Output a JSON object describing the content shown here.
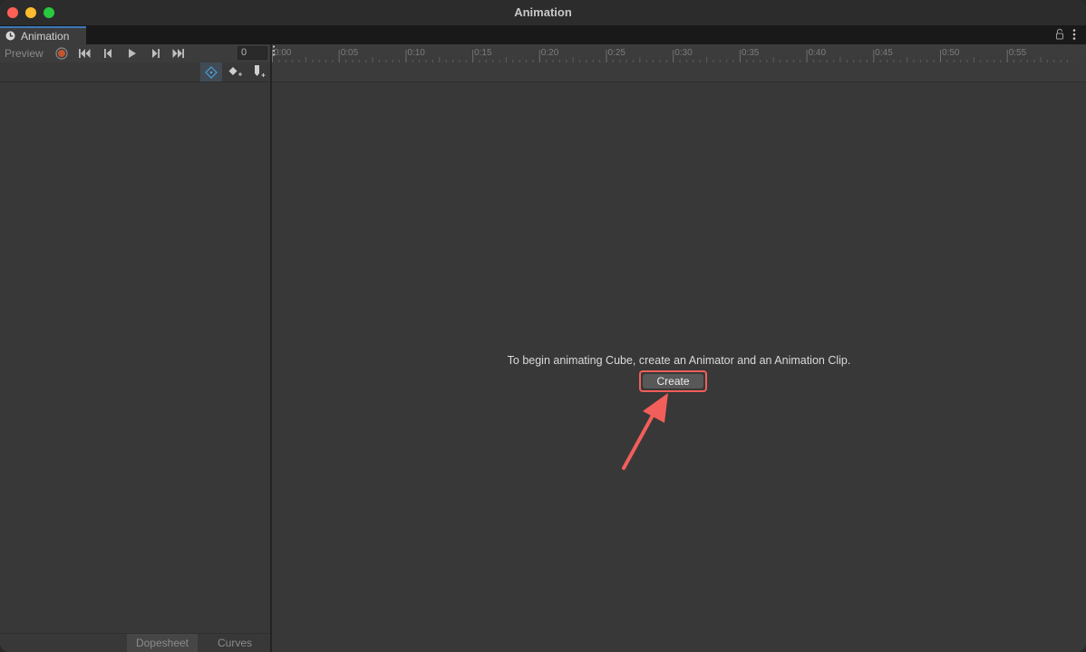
{
  "window": {
    "title": "Animation"
  },
  "tab": {
    "label": "Animation"
  },
  "toolbar": {
    "preview_label": "Preview",
    "frame_value": "0"
  },
  "timeline": {
    "ticks": [
      "0:00",
      "0:05",
      "0:10",
      "0:15",
      "0:20",
      "0:25",
      "0:30",
      "0:35",
      "0:40",
      "0:45",
      "0:50",
      "0:55"
    ]
  },
  "main": {
    "message": "To begin animating Cube, create an Animator and an Animation Clip.",
    "create_label": "Create"
  },
  "bottom_tabs": {
    "dopesheet": "Dopesheet",
    "curves": "Curves"
  },
  "icons": {
    "tab": "clock-icon",
    "lock": "lock-icon",
    "menu": "kebab-menu-icon",
    "record": "record-icon",
    "first_key": "first-keyframe-icon",
    "prev_key": "previous-keyframe-icon",
    "play": "play-icon",
    "next_key": "next-keyframe-icon",
    "last_key": "last-keyframe-icon",
    "filter": "filter-by-selection-icon",
    "add_keyframe": "add-keyframe-icon",
    "add_event": "add-event-icon"
  },
  "colors": {
    "accent": "#3a79bb",
    "highlight": "#f25e5a",
    "record": "#c4552f"
  }
}
